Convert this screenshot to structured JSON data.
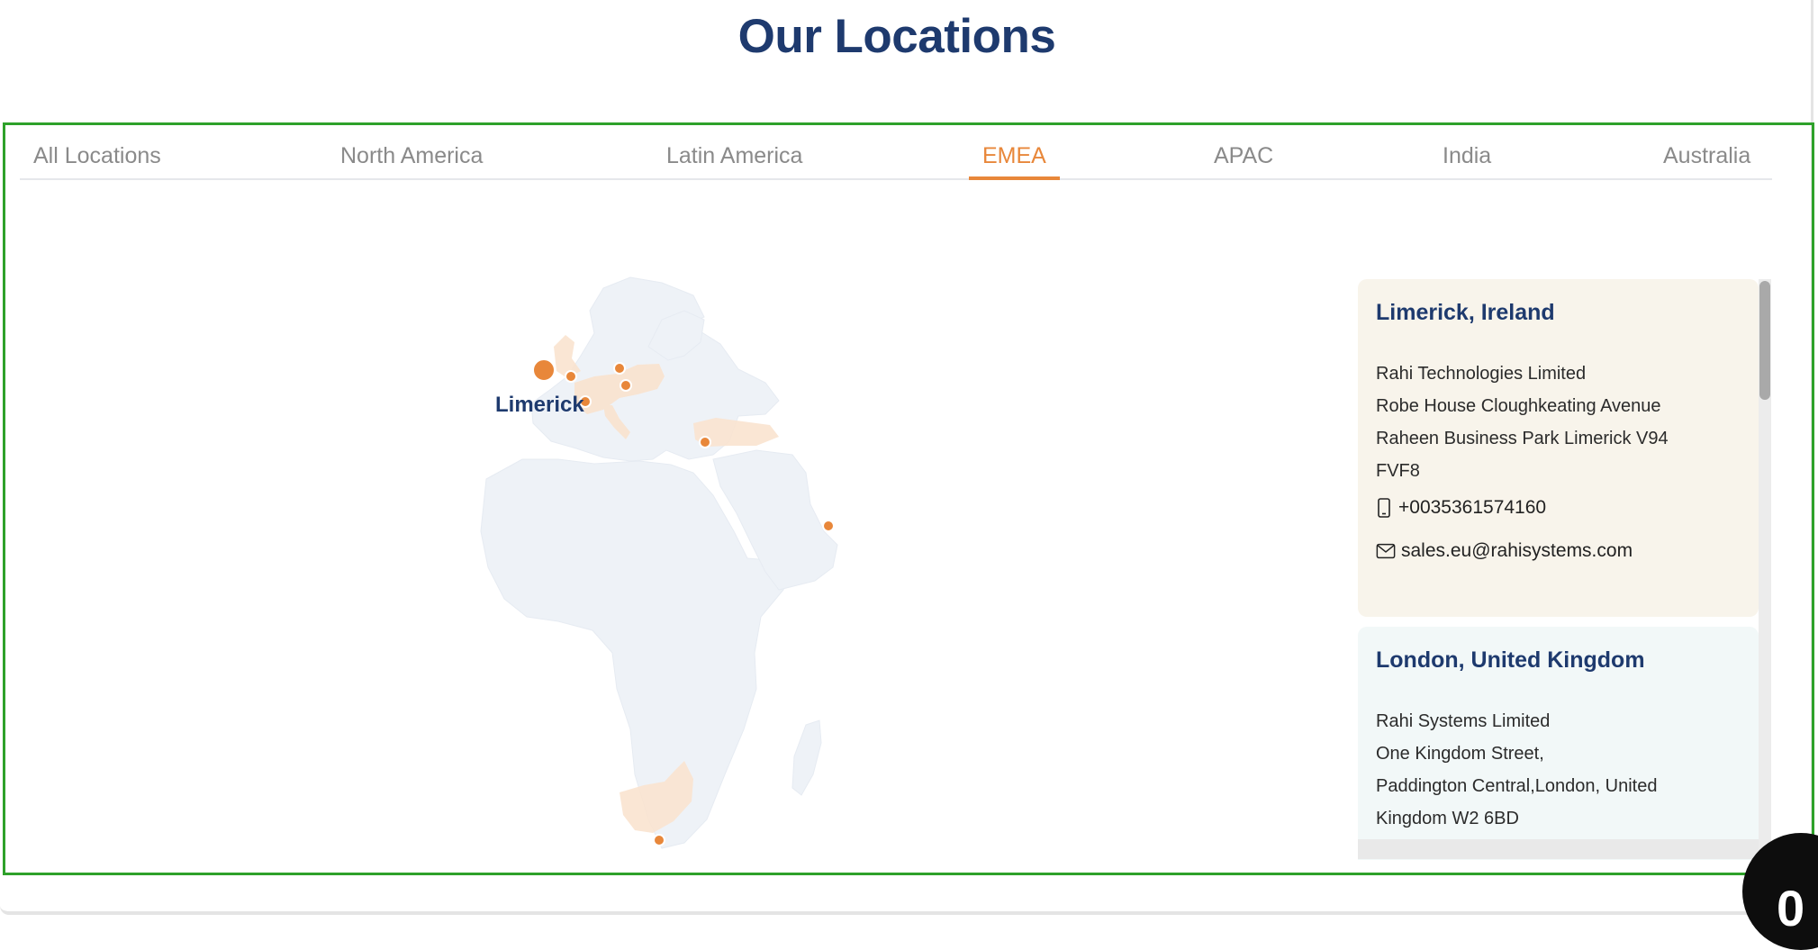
{
  "page": {
    "title": "Our Locations"
  },
  "tabs": [
    {
      "label": "All Locations",
      "active": false
    },
    {
      "label": "North America",
      "active": false
    },
    {
      "label": "Latin America",
      "active": false
    },
    {
      "label": "EMEA",
      "active": true
    },
    {
      "label": "APAC",
      "active": false
    },
    {
      "label": "India",
      "active": false
    },
    {
      "label": "Australia",
      "active": false
    }
  ],
  "map": {
    "selected_label": "Limerick",
    "region": "EMEA",
    "colors": {
      "land": "#eef2f7",
      "highlight": "#fae3cf",
      "marker": "#e8873a"
    }
  },
  "locations": [
    {
      "name": "Limerick, Ireland",
      "address_lines": [
        "Rahi Technologies Limited",
        "Robe House Cloughkeating Avenue",
        "Raheen Business Park Limerick V94",
        "FVF8"
      ],
      "phone": "+0035361574160",
      "email": "sales.eu@rahisystems.com",
      "phone_icon": "mobile-phone-icon",
      "email_icon": "envelope-icon"
    },
    {
      "name": "London, United Kingdom",
      "address_lines": [
        "Rahi Systems Limited",
        "One Kingdom Street,",
        "Paddington Central,London, United",
        "Kingdom W2 6BD"
      ]
    }
  ],
  "badge": {
    "text": "0"
  },
  "colors": {
    "title": "#1e3a6e",
    "accent": "#e8873a",
    "frame": "#2ea12a"
  }
}
